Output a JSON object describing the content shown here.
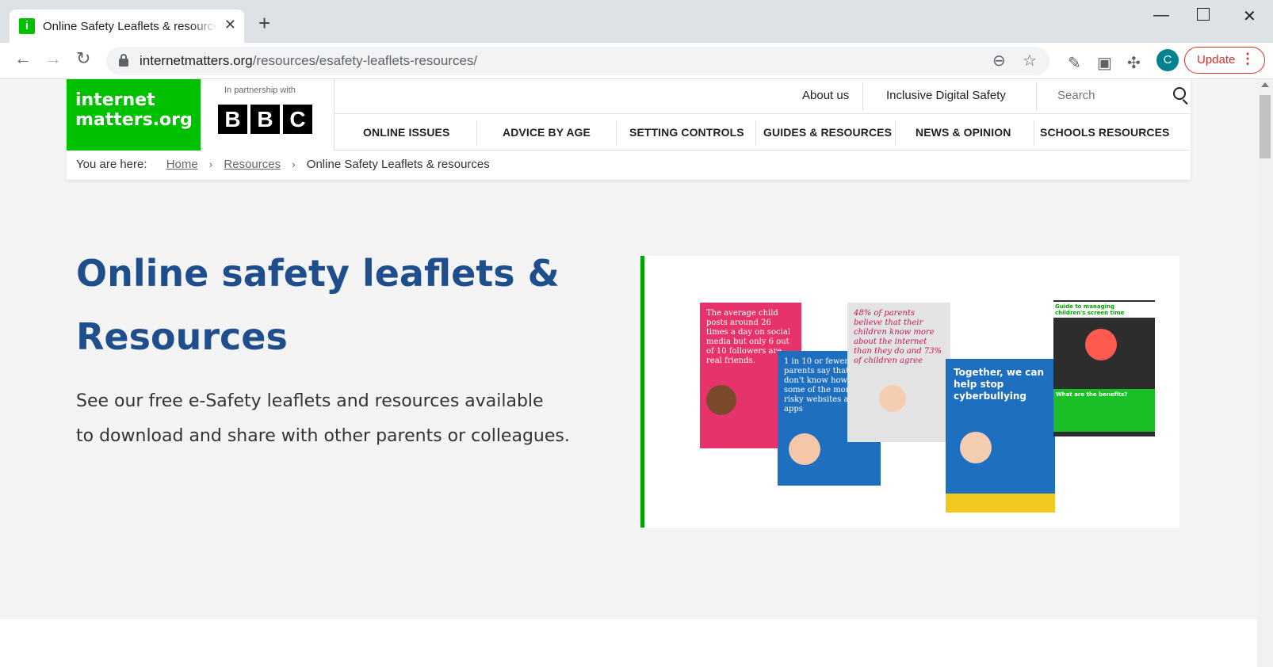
{
  "browser": {
    "tab_title": "Online Safety Leaflets & resources",
    "favicon_glyph": "i",
    "url_host": "internetmatters.org",
    "url_path": "/resources/esafety-leaflets-resources/",
    "profile_initial": "C",
    "update_label": "Update",
    "accent_color": "#d93025"
  },
  "site": {
    "logo_line1": "internet",
    "logo_line2": "matters.org",
    "partner_text": "In partnership with",
    "bbc_letters": [
      "B",
      "B",
      "C"
    ],
    "brand_green": "#00c000"
  },
  "top_links": {
    "about": "About us",
    "inclusive": "Inclusive Digital Safety",
    "search_placeholder": "Search"
  },
  "nav": {
    "items": [
      "ONLINE ISSUES",
      "ADVICE BY AGE",
      "SETTING CONTROLS",
      "GUIDES & RESOURCES",
      "NEWS & OPINION",
      "SCHOOLS RESOURCES"
    ]
  },
  "breadcrumb": {
    "prefix": "You are here:",
    "home": "Home",
    "resources": "Resources",
    "current": "Online Safety Leaflets & resources"
  },
  "hero": {
    "title_line1": "Online safety leaflets &",
    "title_line2": "Resources",
    "desc_line1": "See our free e-Safety leaflets and resources available",
    "desc_line2": "to download and share with other parents or colleagues.",
    "title_color": "#1f4e8c"
  },
  "leaflets": {
    "pink": "The average child posts around 26 times a day on social media but only 6 out of 10 followers are real friends.",
    "blue": "1 in 10 or fewer parents say that they don't know how to use some of the more risky websites and apps",
    "grey": "48% of parents believe that their children know more about the internet than they do and 73% of children agree",
    "cyber": "Together, we can help stop cyberbullying",
    "screen": "Guide to managing children's screen time",
    "benefits": "What are the benefits?"
  }
}
